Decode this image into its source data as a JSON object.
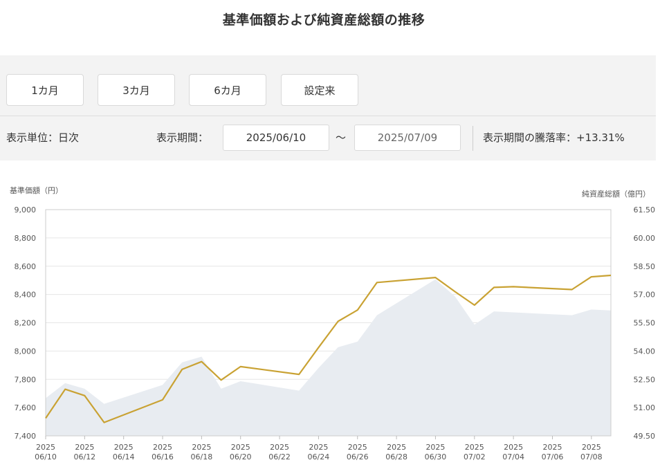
{
  "title": "基準価額および純資産総額の推移",
  "period_buttons": [
    {
      "label": "1カ月"
    },
    {
      "label": "3カ月"
    },
    {
      "label": "6カ月"
    },
    {
      "label": "設定来"
    }
  ],
  "controls": {
    "unit_label": "表示単位：日次",
    "period_label": "表示期間：",
    "start_date": "2025/06/10",
    "tilde": "～",
    "end_date": "2025/07/09",
    "change_rate_label": "表示期間の騰落率：+13.31%"
  },
  "chart_data": {
    "type": "line",
    "ylabel_left": "基準価額（円）",
    "ylabel_right": "純資産総額（億円）",
    "left_ticks": [
      "9,000",
      "8,800",
      "8,600",
      "8,400",
      "8,200",
      "8,000",
      "7,800",
      "7,600",
      "7,400"
    ],
    "right_ticks": [
      "61.50",
      "60.00",
      "58.50",
      "57.00",
      "55.50",
      "54.00",
      "52.50",
      "51.00",
      "49.50"
    ],
    "ylim_left": [
      7400,
      9000
    ],
    "ylim_right": [
      49.5,
      61.5
    ],
    "x_tick_labels": [
      {
        "year": "2025",
        "md": "06/10"
      },
      {
        "year": "2025",
        "md": "06/12"
      },
      {
        "year": "2025",
        "md": "06/14"
      },
      {
        "year": "2025",
        "md": "06/16"
      },
      {
        "year": "2025",
        "md": "06/18"
      },
      {
        "year": "2025",
        "md": "06/20"
      },
      {
        "year": "2025",
        "md": "06/22"
      },
      {
        "year": "2025",
        "md": "06/24"
      },
      {
        "year": "2025",
        "md": "06/26"
      },
      {
        "year": "2025",
        "md": "06/28"
      },
      {
        "year": "2025",
        "md": "06/30"
      },
      {
        "year": "2025",
        "md": "07/02"
      },
      {
        "year": "2025",
        "md": "07/04"
      },
      {
        "year": "2025",
        "md": "07/06"
      },
      {
        "year": "2025",
        "md": "07/08"
      }
    ],
    "x_range": [
      "2025-06-10",
      "2025-07-09"
    ],
    "grid": true,
    "colors": {
      "nav_line": "#c9a233",
      "assets_area": "#e8ecf1",
      "grid": "#e6e6e6"
    },
    "series": [
      {
        "name": "基準価額",
        "axis": "left",
        "points": [
          [
            "2025-06-10",
            7525
          ],
          [
            "2025-06-11",
            7730
          ],
          [
            "2025-06-12",
            7685
          ],
          [
            "2025-06-13",
            7495
          ],
          [
            "2025-06-16",
            7655
          ],
          [
            "2025-06-17",
            7870
          ],
          [
            "2025-06-18",
            7925
          ],
          [
            "2025-06-19",
            7795
          ],
          [
            "2025-06-20",
            7890
          ],
          [
            "2025-06-23",
            7835
          ],
          [
            "2025-06-24",
            8025
          ],
          [
            "2025-06-25",
            8210
          ],
          [
            "2025-06-26",
            8290
          ],
          [
            "2025-06-27",
            8485
          ],
          [
            "2025-06-30",
            8520
          ],
          [
            "2025-07-01",
            8420
          ],
          [
            "2025-07-02",
            8325
          ],
          [
            "2025-07-03",
            8450
          ],
          [
            "2025-07-04",
            8455
          ],
          [
            "2025-07-07",
            8435
          ],
          [
            "2025-07-08",
            8525
          ],
          [
            "2025-07-09",
            8535
          ]
        ]
      },
      {
        "name": "純資産総額",
        "axis": "right",
        "points": [
          [
            "2025-06-10",
            51.5
          ],
          [
            "2025-06-11",
            52.3
          ],
          [
            "2025-06-12",
            52.0
          ],
          [
            "2025-06-13",
            51.2
          ],
          [
            "2025-06-16",
            52.2
          ],
          [
            "2025-06-17",
            53.4
          ],
          [
            "2025-06-18",
            53.7
          ],
          [
            "2025-06-19",
            52.0
          ],
          [
            "2025-06-20",
            52.4
          ],
          [
            "2025-06-23",
            51.9
          ],
          [
            "2025-06-24",
            53.1
          ],
          [
            "2025-06-25",
            54.2
          ],
          [
            "2025-06-26",
            54.5
          ],
          [
            "2025-06-27",
            55.9
          ],
          [
            "2025-06-30",
            57.8
          ],
          [
            "2025-07-01",
            56.9
          ],
          [
            "2025-07-02",
            55.4
          ],
          [
            "2025-07-03",
            56.1
          ],
          [
            "2025-07-04",
            56.05
          ],
          [
            "2025-07-07",
            55.9
          ],
          [
            "2025-07-08",
            56.2
          ],
          [
            "2025-07-09",
            56.15
          ]
        ]
      }
    ]
  }
}
